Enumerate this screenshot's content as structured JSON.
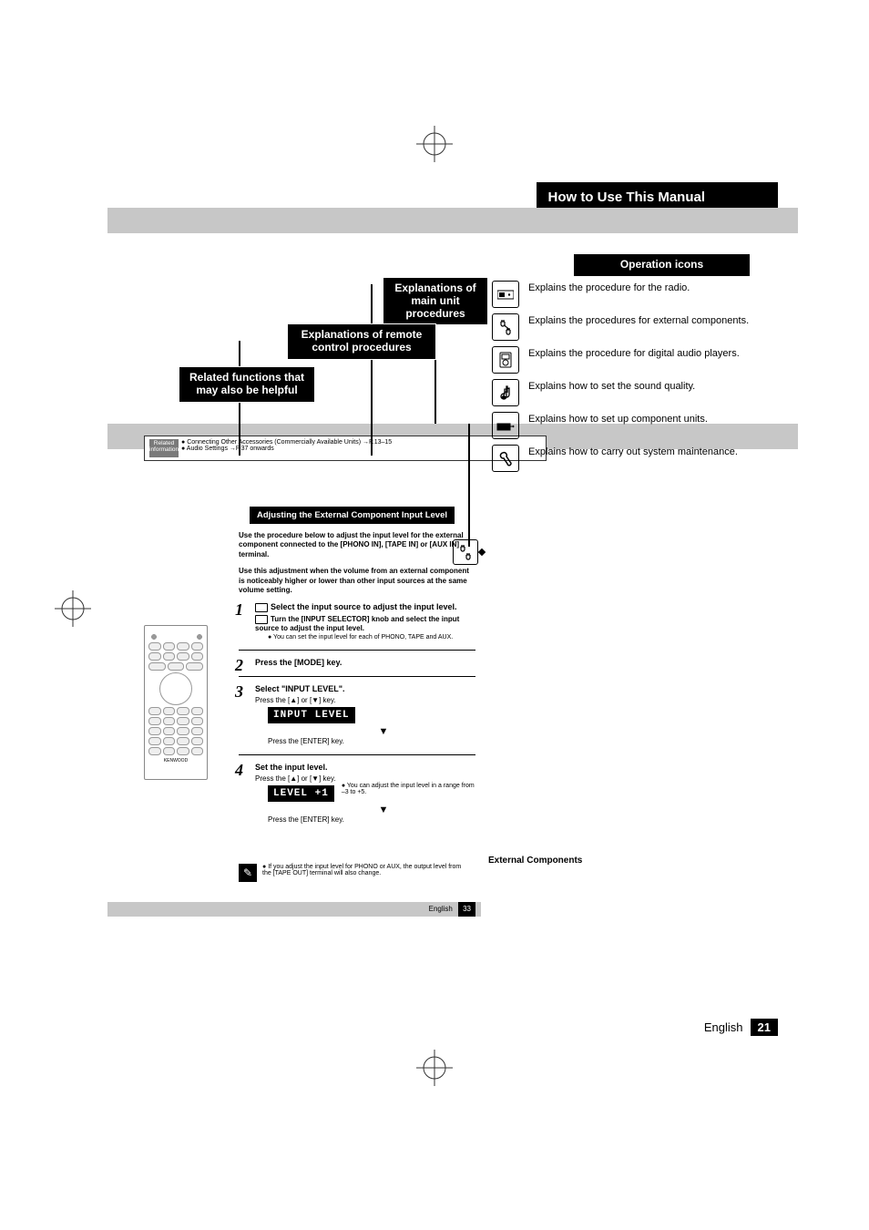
{
  "header": {
    "section_title": "How to Use This Manual"
  },
  "labels": {
    "ops_icons": "Operation icons",
    "main_unit": "Explanations of main unit procedures",
    "remote": "Explanations of remote control procedures",
    "related": "Related functions that may also be helpful",
    "ext_components": "External Components"
  },
  "related_info": {
    "tab": "Related information",
    "items": [
      "Connecting Other Accessories (Commercially Available Units) →P.13–15",
      "Audio Settings →P.37 onwards"
    ]
  },
  "op_icons": [
    {
      "name": "radio-icon",
      "text": "Explains the procedure for the radio."
    },
    {
      "name": "external-components-icon",
      "text": "Explains the procedures for external components."
    },
    {
      "name": "digital-player-icon",
      "text": "Explains the procedure for digital audio players."
    },
    {
      "name": "sound-quality-icon",
      "text": "Explains how to set the sound quality."
    },
    {
      "name": "component-setup-icon",
      "text": "Explains how to set up component units."
    },
    {
      "name": "maintenance-icon",
      "text": "Explains how to carry out system maintenance."
    }
  ],
  "procedure": {
    "title": "Adjusting the External Component Input Level",
    "intro1": "Use the procedure below to adjust the input level for the external component connected to the [PHONO IN], [TAPE IN] or [AUX IN] terminal.",
    "intro2": "Use this adjustment when the volume from an external component is noticeably higher or lower than other input sources at the same volume setting.",
    "step1": {
      "title": "Select the input source to adjust the input level.",
      "main": "Turn the [INPUT SELECTOR] knob and select the input source to adjust the input level.",
      "note": "You can set the input level for each of PHONO, TAPE and AUX."
    },
    "step2": {
      "title": "Press the [MODE] key."
    },
    "step3": {
      "title": "Select \"INPUT LEVEL\".",
      "press": "Press the [▲] or [▼] key.",
      "display": "INPUT LEVEL",
      "enter": "Press the [ENTER] key."
    },
    "step4": {
      "title": "Set the input level.",
      "press": "Press the [▲] or [▼] key.",
      "display": "LEVEL     +1",
      "note": "You can adjust the input level in a range from –3 to +5.",
      "enter": "Press the [ENTER] key."
    },
    "footnote": "If you adjust the input level for PHONO or AUX, the output level from the [TAPE OUT] terminal will also change."
  },
  "subpage_footer": {
    "lang": "English",
    "num": "33"
  },
  "page_footer": {
    "lang": "English",
    "num": "21"
  }
}
